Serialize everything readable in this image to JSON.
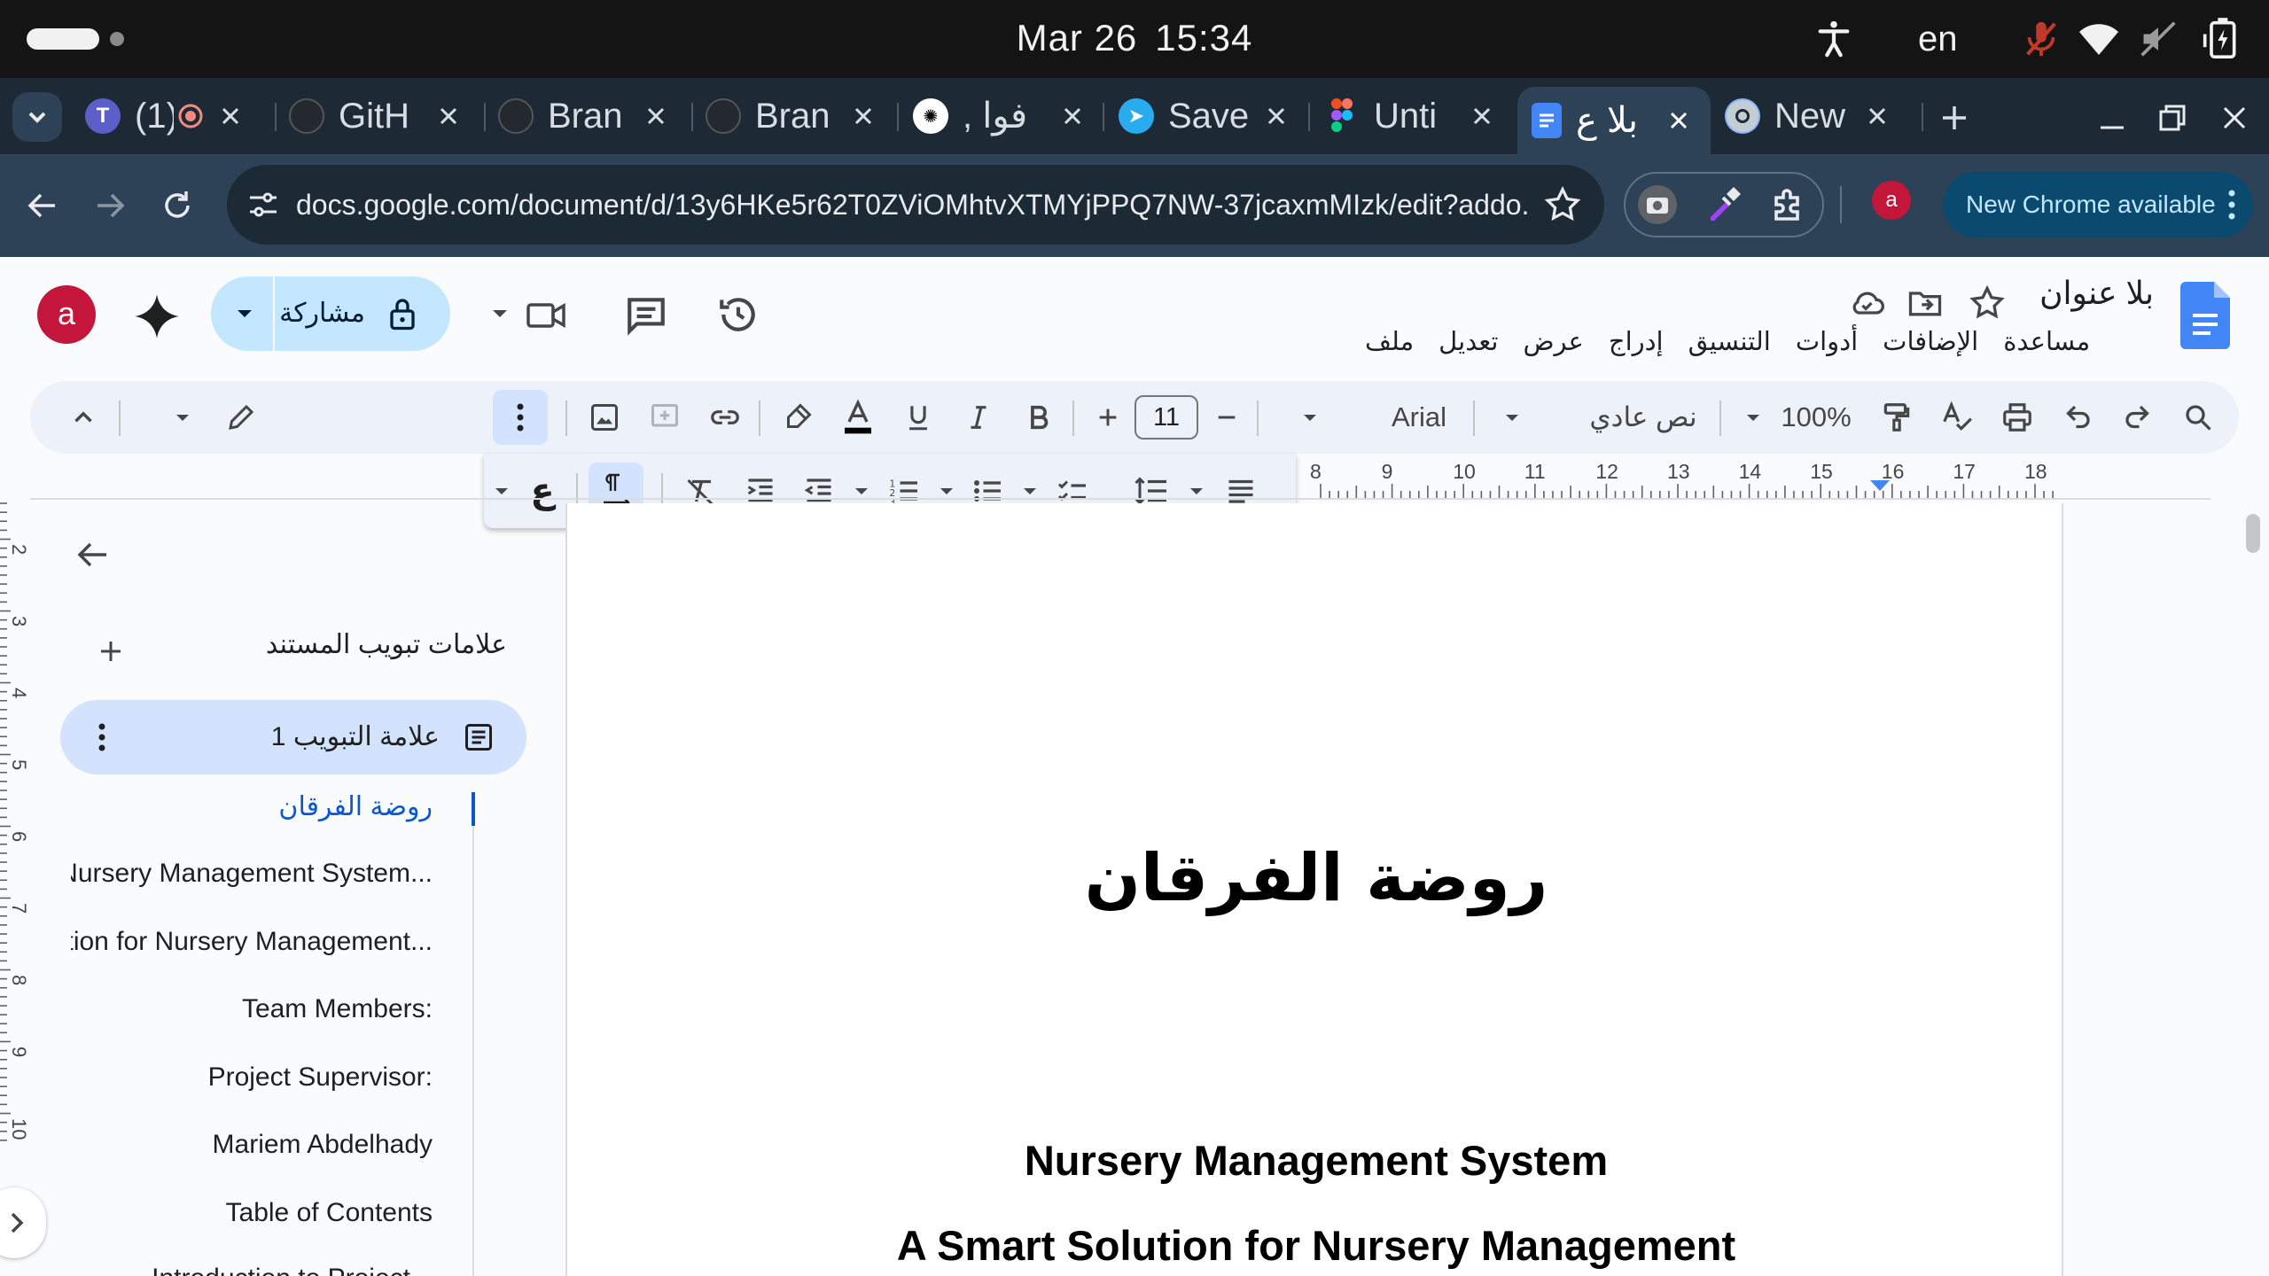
{
  "status_bar": {
    "date": "Mar 26",
    "time": "15:34",
    "lang": "en"
  },
  "tabs": [
    {
      "title": "(1)",
      "icon": "teams-icon",
      "recording": true
    },
    {
      "title": "GitH",
      "icon": "github-icon"
    },
    {
      "title": "Bran",
      "icon": "github-icon"
    },
    {
      "title": "Bran",
      "icon": "github-icon"
    },
    {
      "title": "فوا ,",
      "icon": "openai-icon"
    },
    {
      "title": "Save",
      "icon": "telegram-icon"
    },
    {
      "title": "Unti",
      "icon": "figma-icon"
    },
    {
      "title": "بلا ع",
      "icon": "docs-icon",
      "active": true
    },
    {
      "title": "New",
      "icon": "chrome-icon"
    }
  ],
  "browser": {
    "url": "docs.google.com/document/d/13y6HKe5r62T0ZViOMhtvXTMYjPPQ7NW-37jcaxmMIzk/edit?addo...",
    "profile_initial": "a",
    "update_label": "New Chrome available"
  },
  "docs": {
    "title": "بلا عنوان",
    "menu": [
      "ملف",
      "تعديل",
      "عرض",
      "إدراج",
      "التنسيق",
      "أدوات",
      "الإضافات",
      "مساعدة"
    ],
    "share_label": "مشاركة",
    "avatar_initial": "a",
    "toolbar": {
      "zoom": "100%",
      "style": "نص عادي",
      "font": "Arial",
      "font_size": "11"
    },
    "ruler_numbers": [
      "8",
      "9",
      "10",
      "11",
      "12",
      "13",
      "14",
      "15",
      "16",
      "17",
      "18"
    ],
    "ruler_vertical": [
      "2",
      "3",
      "4",
      "5",
      "6",
      "7",
      "8",
      "9",
      "10"
    ]
  },
  "outline": {
    "heading": "علامات تبويب المستند",
    "tab_name": "علامة التبويب 1",
    "items": [
      "روضة الفرقان",
      "Nursery Management System...",
      "A Smart Solution for Nursery Management...",
      "Team Members:",
      "Project Supervisor:",
      "Mariem Abdelhady",
      "Table of Contents",
      "Introduction to Project..."
    ]
  },
  "document": {
    "heading_ar": "روضة الفرقان",
    "heading_1": "Nursery Management System",
    "heading_2": "A Smart Solution for Nursery Management"
  },
  "colors": {
    "accent": "#0b57d0",
    "share_bg": "#c2e7ff",
    "active_tab": "#d3e3fd",
    "profile": "#c4153a"
  }
}
